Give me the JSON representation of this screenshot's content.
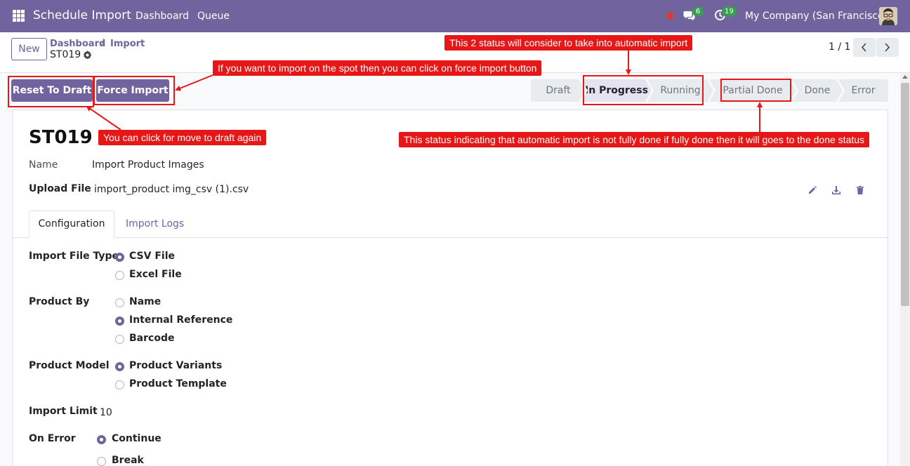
{
  "navbar": {
    "app_title": "Schedule Import",
    "menu": [
      "Dashboard",
      "Queue"
    ],
    "messages_badge": "6",
    "activities_badge": "19",
    "company": "My Company (San Francisco)"
  },
  "control_panel": {
    "new_button": "New",
    "breadcrumb": [
      "Dashboard",
      "Import"
    ],
    "breadcrumb_sep": "/",
    "record_name": "ST019",
    "pager": "1 / 1"
  },
  "actions": {
    "reset_to_draft": "Reset To Draft",
    "force_import": "Force Import"
  },
  "statusbar": {
    "stages": [
      "Draft",
      "In Progress",
      "Running",
      "Partial Done",
      "Done",
      "Error"
    ],
    "active": "In Progress"
  },
  "form": {
    "title": "ST019",
    "name_label": "Name",
    "name_value": "Import Product Images",
    "upload_label": "Upload File",
    "upload_value": "import_product img_csv (1).csv",
    "tabs": [
      "Configuration",
      "Import Logs"
    ],
    "import_file_type": {
      "label": "Import File Type",
      "options": [
        "CSV File",
        "Excel File"
      ],
      "selected": "CSV File"
    },
    "product_by": {
      "label": "Product By",
      "options": [
        "Name",
        "Internal Reference",
        "Barcode"
      ],
      "selected": "Internal Reference"
    },
    "product_model": {
      "label": "Product Model",
      "options": [
        "Product Variants",
        "Product Template"
      ],
      "selected": "Product Variants"
    },
    "import_limit": {
      "label": "Import Limit",
      "value": "10"
    },
    "on_error": {
      "label": "On Error",
      "options": [
        "Continue",
        "Break"
      ],
      "selected": "Continue"
    }
  },
  "annotations": {
    "status_note": "This 2 status will consider to take into automatic import",
    "force_note": "If you want to import on the spot then you can click on force import button",
    "draft_note": "You can click for move to draft again",
    "partial_note": "This status indicating that automatic import is not fully done if fully done then it will goes to the done status"
  },
  "colors": {
    "brand": "#71639e",
    "annotation": "#e81717",
    "badge": "#3c9b52"
  }
}
